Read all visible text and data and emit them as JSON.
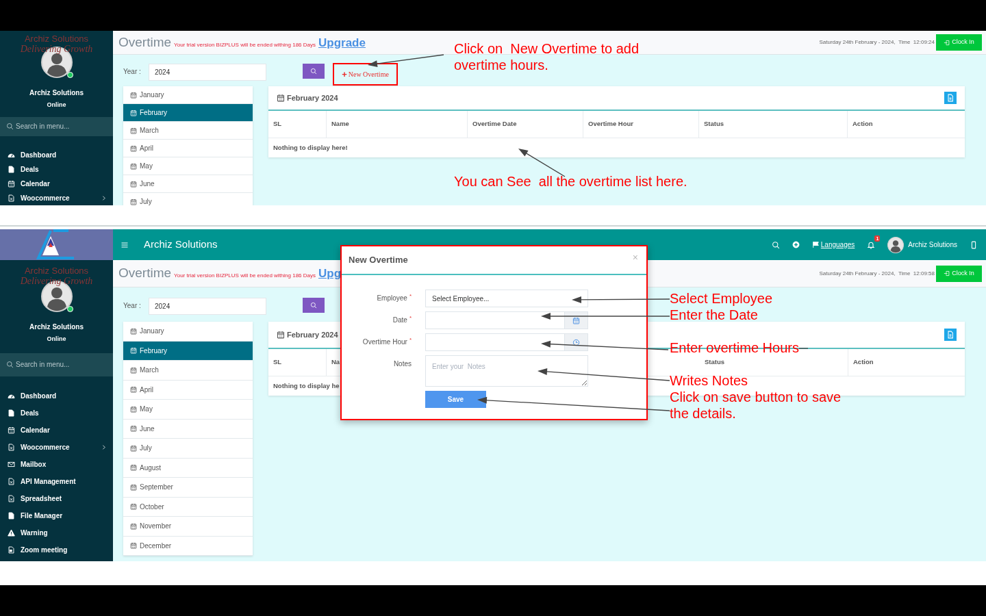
{
  "screens": [
    {
      "sidebar": {
        "logo_name": "Archiz Solutions",
        "logo_tagline": "Delivering Growth",
        "user_name": "Archiz Solutions",
        "user_status": "Online",
        "online": true,
        "search_placeholder": "Search in menu...",
        "menu": [
          {
            "label": "Dashboard",
            "has_submenu": false
          },
          {
            "label": "Deals",
            "has_submenu": false
          },
          {
            "label": "Calendar",
            "has_submenu": false
          },
          {
            "label": "Woocommerce",
            "has_submenu": true
          }
        ]
      },
      "header": {
        "title": "Overtime",
        "trial_notice": "Your trial version BIZPLUS will be ended withing 186 Days",
        "upgrade": "Upgrade",
        "date_time": "Saturday 24th February - 2024,  Time  12:09:24",
        "clock_in": "Clock In"
      },
      "year": {
        "label": "Year :",
        "value": "2024"
      },
      "new_overtime": {
        "icon": "+",
        "label": "New Overtime"
      },
      "months": [
        {
          "label": "January",
          "selected": false
        },
        {
          "label": "February",
          "selected": true
        },
        {
          "label": "March",
          "selected": false
        },
        {
          "label": "April",
          "selected": false
        },
        {
          "label": "May",
          "selected": false
        },
        {
          "label": "June",
          "selected": false
        },
        {
          "label": "July",
          "selected": false
        }
      ],
      "panel": {
        "title": "February 2024",
        "columns": [
          "SL",
          "Name",
          "Overtime Date",
          "Overtime Hour",
          "Status",
          "Action"
        ],
        "empty_text": "Nothing to display here!"
      },
      "annotations": [
        "Click on  New Overtime to add overtime hours.",
        "You can See  all the overtime list here."
      ]
    },
    {
      "sidebar": {
        "logo_name": "Archiz Solutions",
        "logo_tagline": "Delivering Growth",
        "user_name": "Archiz Solutions",
        "user_status": "Online",
        "online": true,
        "search_placeholder": "Search in menu...",
        "menu": [
          {
            "label": "Dashboard",
            "has_submenu": false
          },
          {
            "label": "Deals",
            "has_submenu": false
          },
          {
            "label": "Calendar",
            "has_submenu": false
          },
          {
            "label": "Woocommerce",
            "has_submenu": true
          },
          {
            "label": "Mailbox",
            "has_submenu": false
          },
          {
            "label": "API Management",
            "has_submenu": false
          },
          {
            "label": "Spreadsheet",
            "has_submenu": false
          },
          {
            "label": "File Manager",
            "has_submenu": false
          },
          {
            "label": "Warning",
            "has_submenu": false
          },
          {
            "label": "Zoom meeting",
            "has_submenu": false
          }
        ]
      },
      "navbar": {
        "brand": "Archiz Solutions",
        "languages": "Languages",
        "notification_count": "1",
        "user_name": "Archiz Solutions"
      },
      "header": {
        "title": "Overtime",
        "trial_notice": "Your trial version BIZPLUS will be ended withing 186 Days",
        "upgrade": "Upg",
        "date_time": "Saturday 24th February - 2024,  Time  12:09:58",
        "clock_in": "Clock In"
      },
      "year": {
        "label": "Year :",
        "value": "2024"
      },
      "months": [
        {
          "label": "January",
          "selected": false
        },
        {
          "label": "February",
          "selected": true
        },
        {
          "label": "March",
          "selected": false
        },
        {
          "label": "April",
          "selected": false
        },
        {
          "label": "May",
          "selected": false
        },
        {
          "label": "June",
          "selected": false
        },
        {
          "label": "July",
          "selected": false
        },
        {
          "label": "August",
          "selected": false
        },
        {
          "label": "September",
          "selected": false
        },
        {
          "label": "October",
          "selected": false
        },
        {
          "label": "November",
          "selected": false
        },
        {
          "label": "December",
          "selected": false
        }
      ],
      "panel": {
        "title": "February 2024",
        "columns": [
          "SL",
          "Na",
          "Status",
          "Action"
        ],
        "empty_text": "Nothing to display he"
      },
      "modal": {
        "title": "New Overtime",
        "close": "×",
        "fields": [
          {
            "kind": "select",
            "label": "Employee",
            "required_mark": "*",
            "value": "Select Employee..."
          },
          {
            "kind": "date",
            "label": "Date",
            "required_mark": "*"
          },
          {
            "kind": "time",
            "label": "Overtime Hour",
            "required_mark": "*"
          },
          {
            "kind": "textarea",
            "label": "Notes",
            "placeholder": "Enter your  Notes"
          }
        ],
        "save": "Save"
      },
      "annotations": [
        "Select Employee",
        "Enter the Date",
        "Enter overtime Hours",
        "Writes Notes",
        "Click on save button to save the details."
      ]
    }
  ]
}
